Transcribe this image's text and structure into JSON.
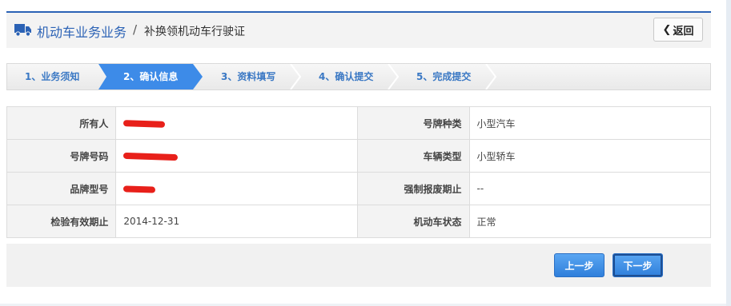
{
  "header": {
    "title": "机动车业务业务",
    "separator": "/",
    "subtitle": "补换领机动车行驶证",
    "back_label": "返回",
    "accent_color": "#2b62b5"
  },
  "steps": [
    {
      "label": "1、业务须知",
      "active": false
    },
    {
      "label": "2、确认信息",
      "active": true
    },
    {
      "label": "3、资料填写",
      "active": false
    },
    {
      "label": "4、确认提交",
      "active": false
    },
    {
      "label": "5、完成提交",
      "active": false
    }
  ],
  "info": {
    "rows": [
      {
        "label_left": "所有人",
        "value_left": "",
        "label_right": "号牌种类",
        "value_right": "小型汽车"
      },
      {
        "label_left": "号牌号码",
        "value_left": "",
        "label_right": "车辆类型",
        "value_right": "小型轿车"
      },
      {
        "label_left": "品牌型号",
        "value_left": "",
        "label_right": "强制报废期止",
        "value_right": "--"
      },
      {
        "label_left": "检验有效期止",
        "value_left": "2014-12-31",
        "label_right": "机动车状态",
        "value_right": "正常"
      }
    ],
    "redaction_color": "#e8201a"
  },
  "footer": {
    "prev_label": "上一步",
    "next_label": "下一步"
  }
}
